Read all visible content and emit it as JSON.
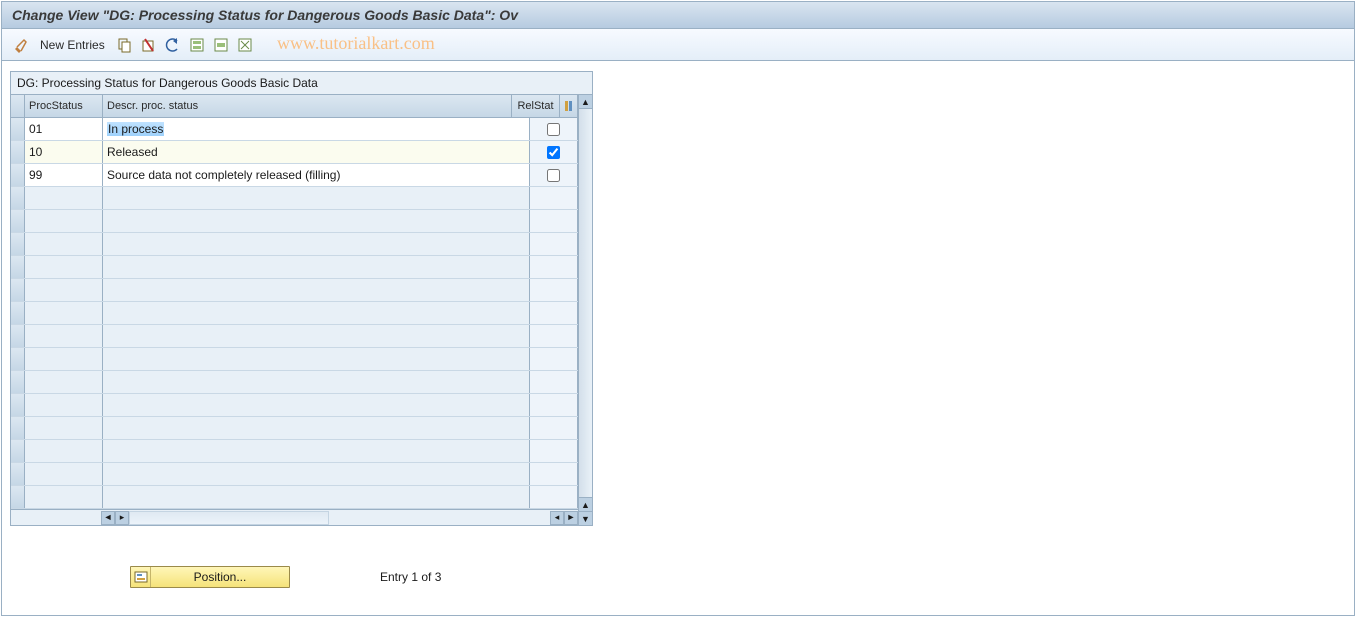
{
  "header": {
    "title": "Change View \"DG: Processing Status for Dangerous Goods Basic Data\": Ov"
  },
  "toolbar": {
    "new_entries_label": "New Entries"
  },
  "watermark": "www.tutorialkart.com",
  "panel": {
    "title": "DG: Processing Status for Dangerous Goods Basic Data"
  },
  "columns": {
    "proc_status": "ProcStatus",
    "descr": "Descr. proc. status",
    "rel_stat": "RelStat"
  },
  "rows": [
    {
      "proc": "01",
      "descr": "In process",
      "rel": false,
      "highlighted": true
    },
    {
      "proc": "10",
      "descr": "Released",
      "rel": true,
      "highlighted": false
    },
    {
      "proc": "99",
      "descr": "Source data not completely released (filling)",
      "rel": false,
      "highlighted": false
    }
  ],
  "empty_row_count": 14,
  "footer": {
    "position_label": "Position...",
    "entry_label": "Entry 1 of 3"
  }
}
